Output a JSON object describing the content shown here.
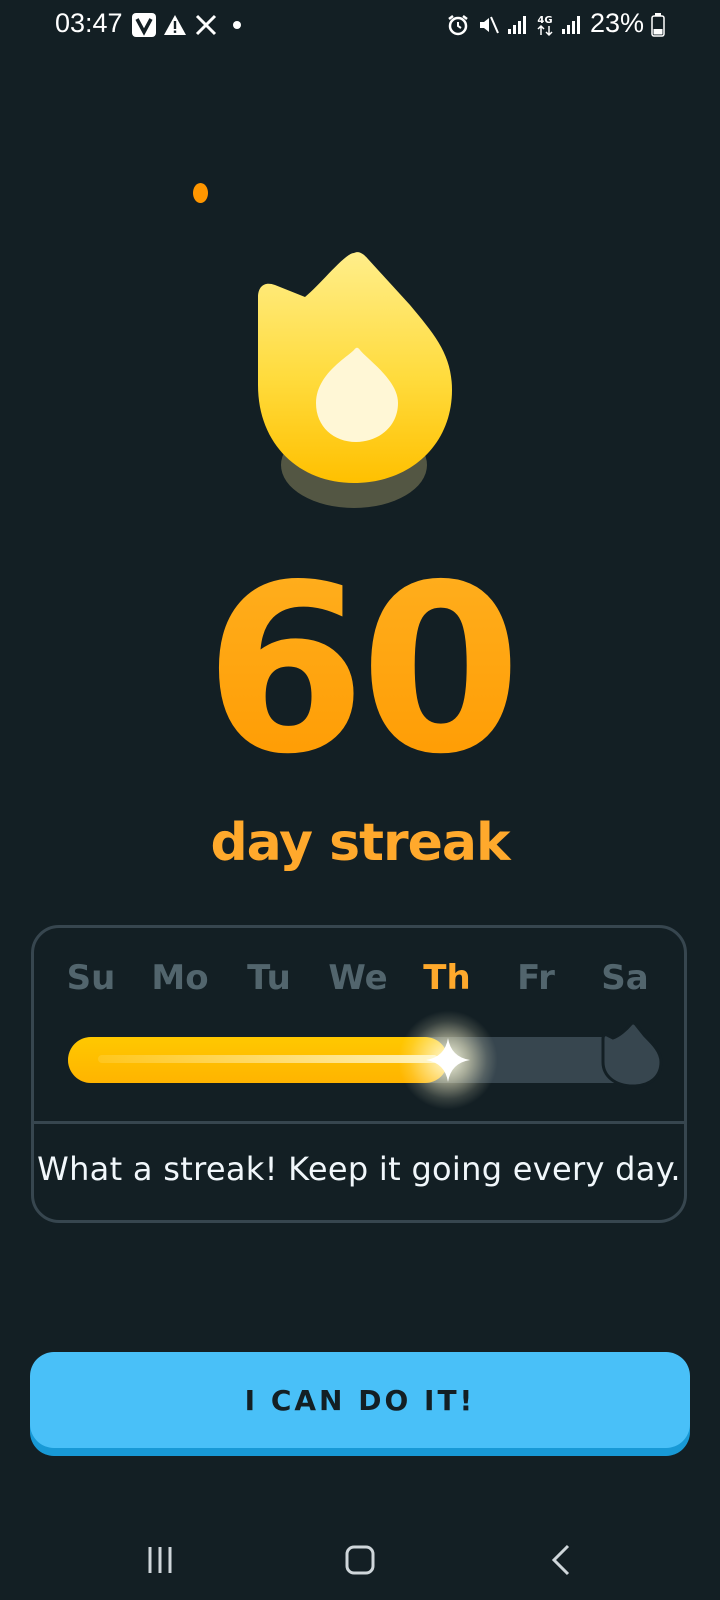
{
  "status_bar": {
    "time": "03:47",
    "battery_percent": "23%",
    "icons": [
      "v-app-icon",
      "warning-icon",
      "x-app-icon",
      "notification-dot-icon",
      "alarm-icon",
      "mute-icon",
      "signal-icon",
      "4g-icon",
      "signal-icon",
      "battery-icon"
    ]
  },
  "streak": {
    "count": "60",
    "label": "day streak"
  },
  "week": {
    "days": [
      "Su",
      "Mo",
      "Tu",
      "We",
      "Th",
      "Fr",
      "Sa"
    ],
    "active_day": "Th",
    "progress_fraction": 0.66,
    "message": "What a streak! Keep it going every day."
  },
  "cta": {
    "label": "I CAN DO IT!"
  },
  "colors": {
    "background": "#131f24",
    "streak_orange": "#ffa92c",
    "progress_yellow": "#ffc800",
    "track": "#37464f",
    "button_blue": "#49c0f8",
    "button_shadow": "#1899d6"
  },
  "nav": {
    "icons": [
      "recent-apps-icon",
      "home-icon",
      "back-icon"
    ]
  }
}
